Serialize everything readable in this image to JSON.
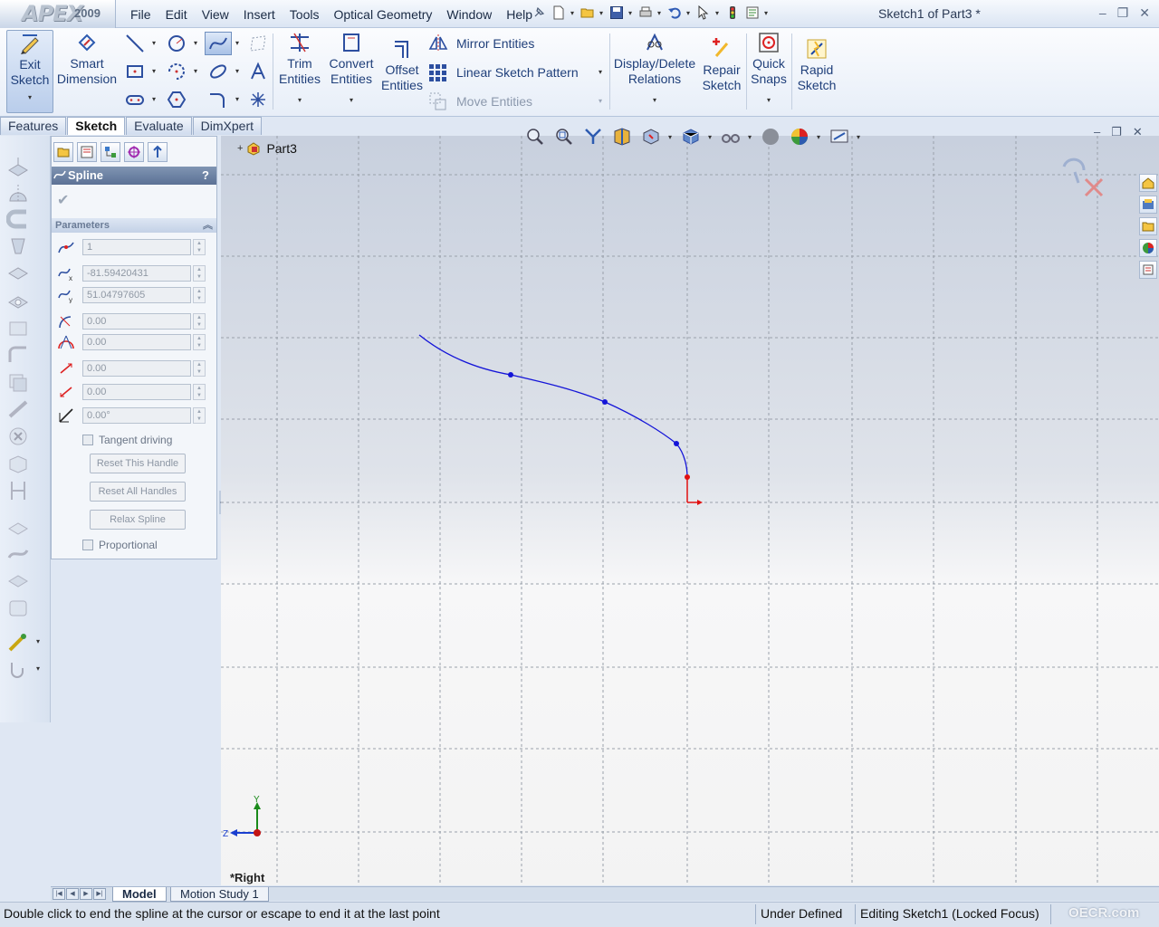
{
  "app": {
    "brand": "APEX",
    "year": "2009",
    "document_title": "Sketch1 of Part3 *"
  },
  "menu": [
    "File",
    "Edit",
    "View",
    "Insert",
    "Tools",
    "Optical Geometry",
    "Window",
    "Help"
  ],
  "command_manager": {
    "exit_sketch": "Exit\nSketch",
    "smart_dimension": "Smart\nDimension",
    "trim_entities": "Trim\nEntities",
    "convert_entities": "Convert\nEntities",
    "offset_entities": "Offset\nEntities",
    "mirror_entities": "Mirror Entities",
    "linear_sketch_pattern": "Linear Sketch Pattern",
    "move_entities": "Move Entities",
    "display_delete_relations": "Display/Delete\nRelations",
    "repair_sketch": "Repair\nSketch",
    "quick_snaps": "Quick\nSnaps",
    "rapid_sketch": "Rapid\nSketch"
  },
  "tabs": [
    {
      "label": "Features",
      "active": false
    },
    {
      "label": "Sketch",
      "active": true
    },
    {
      "label": "Evaluate",
      "active": false
    },
    {
      "label": "DimXpert",
      "active": false
    }
  ],
  "property_manager": {
    "title": "Spline",
    "help": "?",
    "section_title": "Parameters",
    "spline_point_number": "1",
    "x_coordinate": "-81.59420431",
    "y_coordinate": "51.04797605",
    "radius_of_curvature": "0.00",
    "curvature": "0.00",
    "tangent_weight_1": "0.00",
    "tangent_weight_2": "0.00",
    "tangent_radial_direction": "0.00°",
    "tangent_driving_label": "Tangent driving",
    "reset_this_handle": "Reset This Handle",
    "reset_all_handles": "Reset All Handles",
    "relax_spline": "Relax Spline",
    "proportional_label": "Proportional"
  },
  "graphics": {
    "tree_root": "Part3",
    "view_name": "*Right",
    "axis_y": "Y",
    "axis_z": "Z",
    "spline_color": "#1414d8",
    "origin_color": "#e01010"
  },
  "bottom_tabs": {
    "model": "Model",
    "motion_study": "Motion Study 1"
  },
  "status": {
    "message": "Double click to end the spline at the cursor or escape to end it at the last point",
    "definition_state": "Under Defined",
    "editing": "Editing Sketch1 (Locked Focus)",
    "watermark": "OECR.com"
  }
}
